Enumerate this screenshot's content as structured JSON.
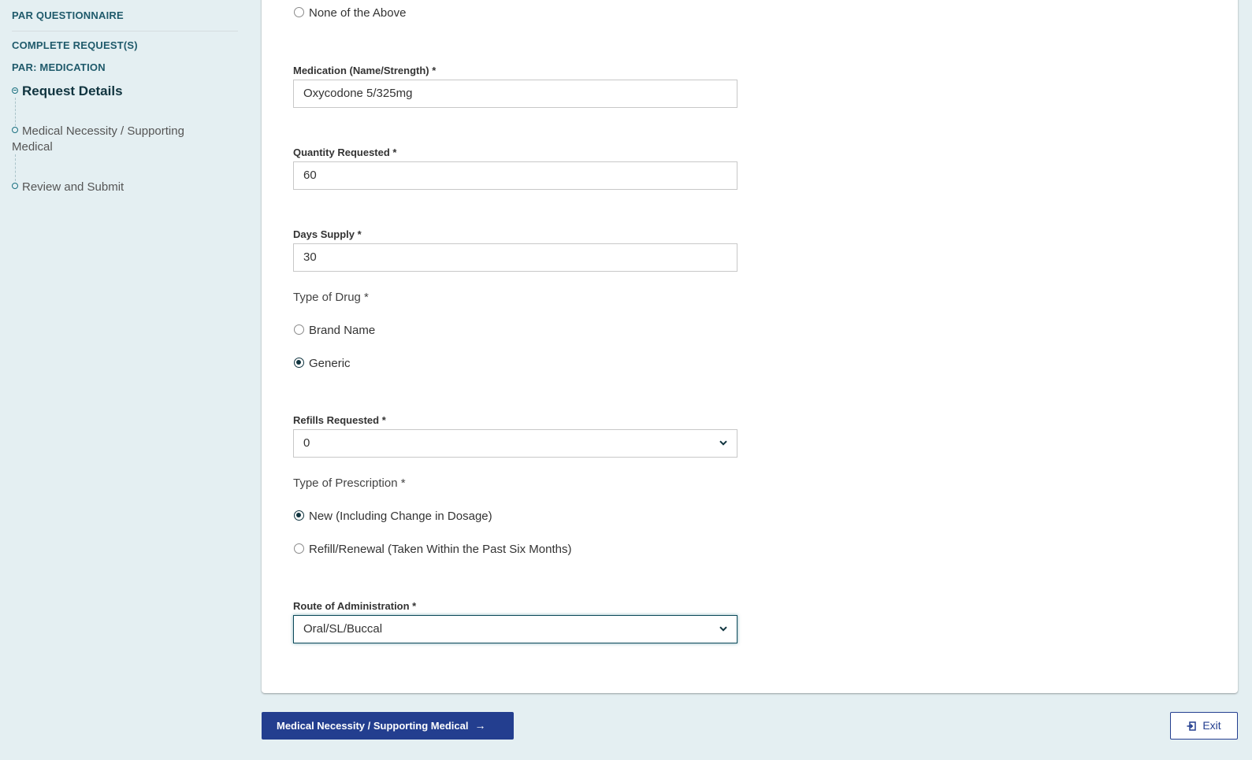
{
  "sidebar": {
    "heading_questionnaire": "PAR QUESTIONNAIRE",
    "heading_complete": "COMPLETE REQUEST(S)",
    "heading_medication": "PAR: MEDICATION",
    "steps": [
      {
        "label": "Request Details",
        "state": "active"
      },
      {
        "label": "Medical Necessity / Supporting Medical",
        "state": "pending"
      },
      {
        "label": "Review and Submit",
        "state": "pending"
      }
    ]
  },
  "form": {
    "prior_option": {
      "label": "None of the Above",
      "checked": false
    },
    "medication": {
      "label": "Medication (Name/Strength) *",
      "value": "Oxycodone 5/325mg"
    },
    "quantity": {
      "label": "Quantity Requested *",
      "value": "60"
    },
    "days_supply": {
      "label": "Days Supply *",
      "value": "30"
    },
    "drug_type": {
      "label": "Type of Drug *",
      "options": [
        {
          "label": "Brand Name",
          "checked": false
        },
        {
          "label": "Generic",
          "checked": true
        }
      ]
    },
    "refills": {
      "label": "Refills Requested *",
      "value": "0"
    },
    "prescription_type": {
      "label": "Type of Prescription *",
      "options": [
        {
          "label": "New (Including Change in Dosage)",
          "checked": true
        },
        {
          "label": "Refill/Renewal (Taken Within the Past Six Months)",
          "checked": false
        }
      ]
    },
    "route": {
      "label": "Route of Administration *",
      "value": "Oral/SL/Buccal"
    }
  },
  "footer": {
    "next_label": "Medical Necessity / Supporting Medical",
    "next_icon": "arrow-right-icon",
    "exit_label": "Exit",
    "exit_icon": "exit-icon"
  },
  "colors": {
    "background": "#e4eff2",
    "primary": "#233e8f",
    "accent": "#1b7080",
    "heading": "#1f5a6b"
  }
}
